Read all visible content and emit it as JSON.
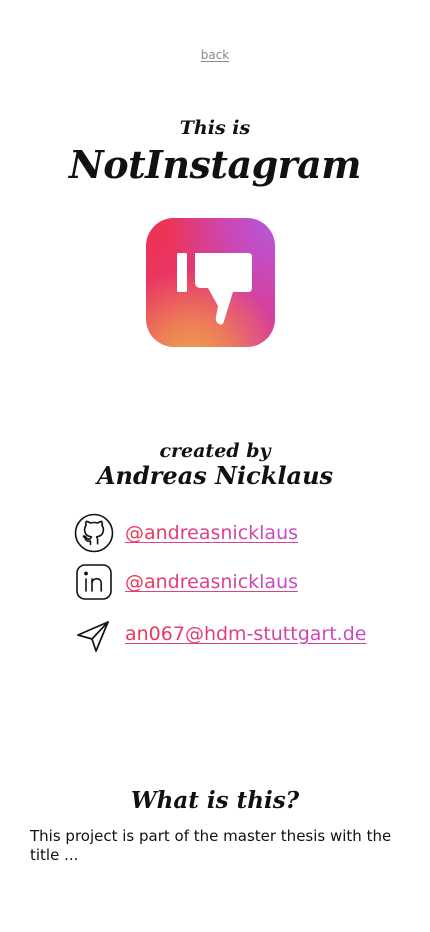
{
  "nav": {
    "back_label": "back"
  },
  "hero": {
    "intro": "This is",
    "app_name": "NotInstagram",
    "app_icon": "thumbs-down-icon"
  },
  "credits": {
    "created_by": "created by",
    "author": "Andreas Nicklaus",
    "contacts": [
      {
        "icon": "github-icon",
        "label": "@andreasnicklaus"
      },
      {
        "icon": "linkedin-icon",
        "label": "@andreasnicklaus"
      },
      {
        "icon": "send-icon",
        "label": "an067@hdm-stuttgart.de"
      }
    ]
  },
  "about": {
    "title": "What is this?",
    "text": "This project is part of the master thesis with the title ..."
  },
  "colors": {
    "accent_start": "#f0344e",
    "accent_end": "#c44ad0",
    "muted": "#8a8a8a"
  }
}
